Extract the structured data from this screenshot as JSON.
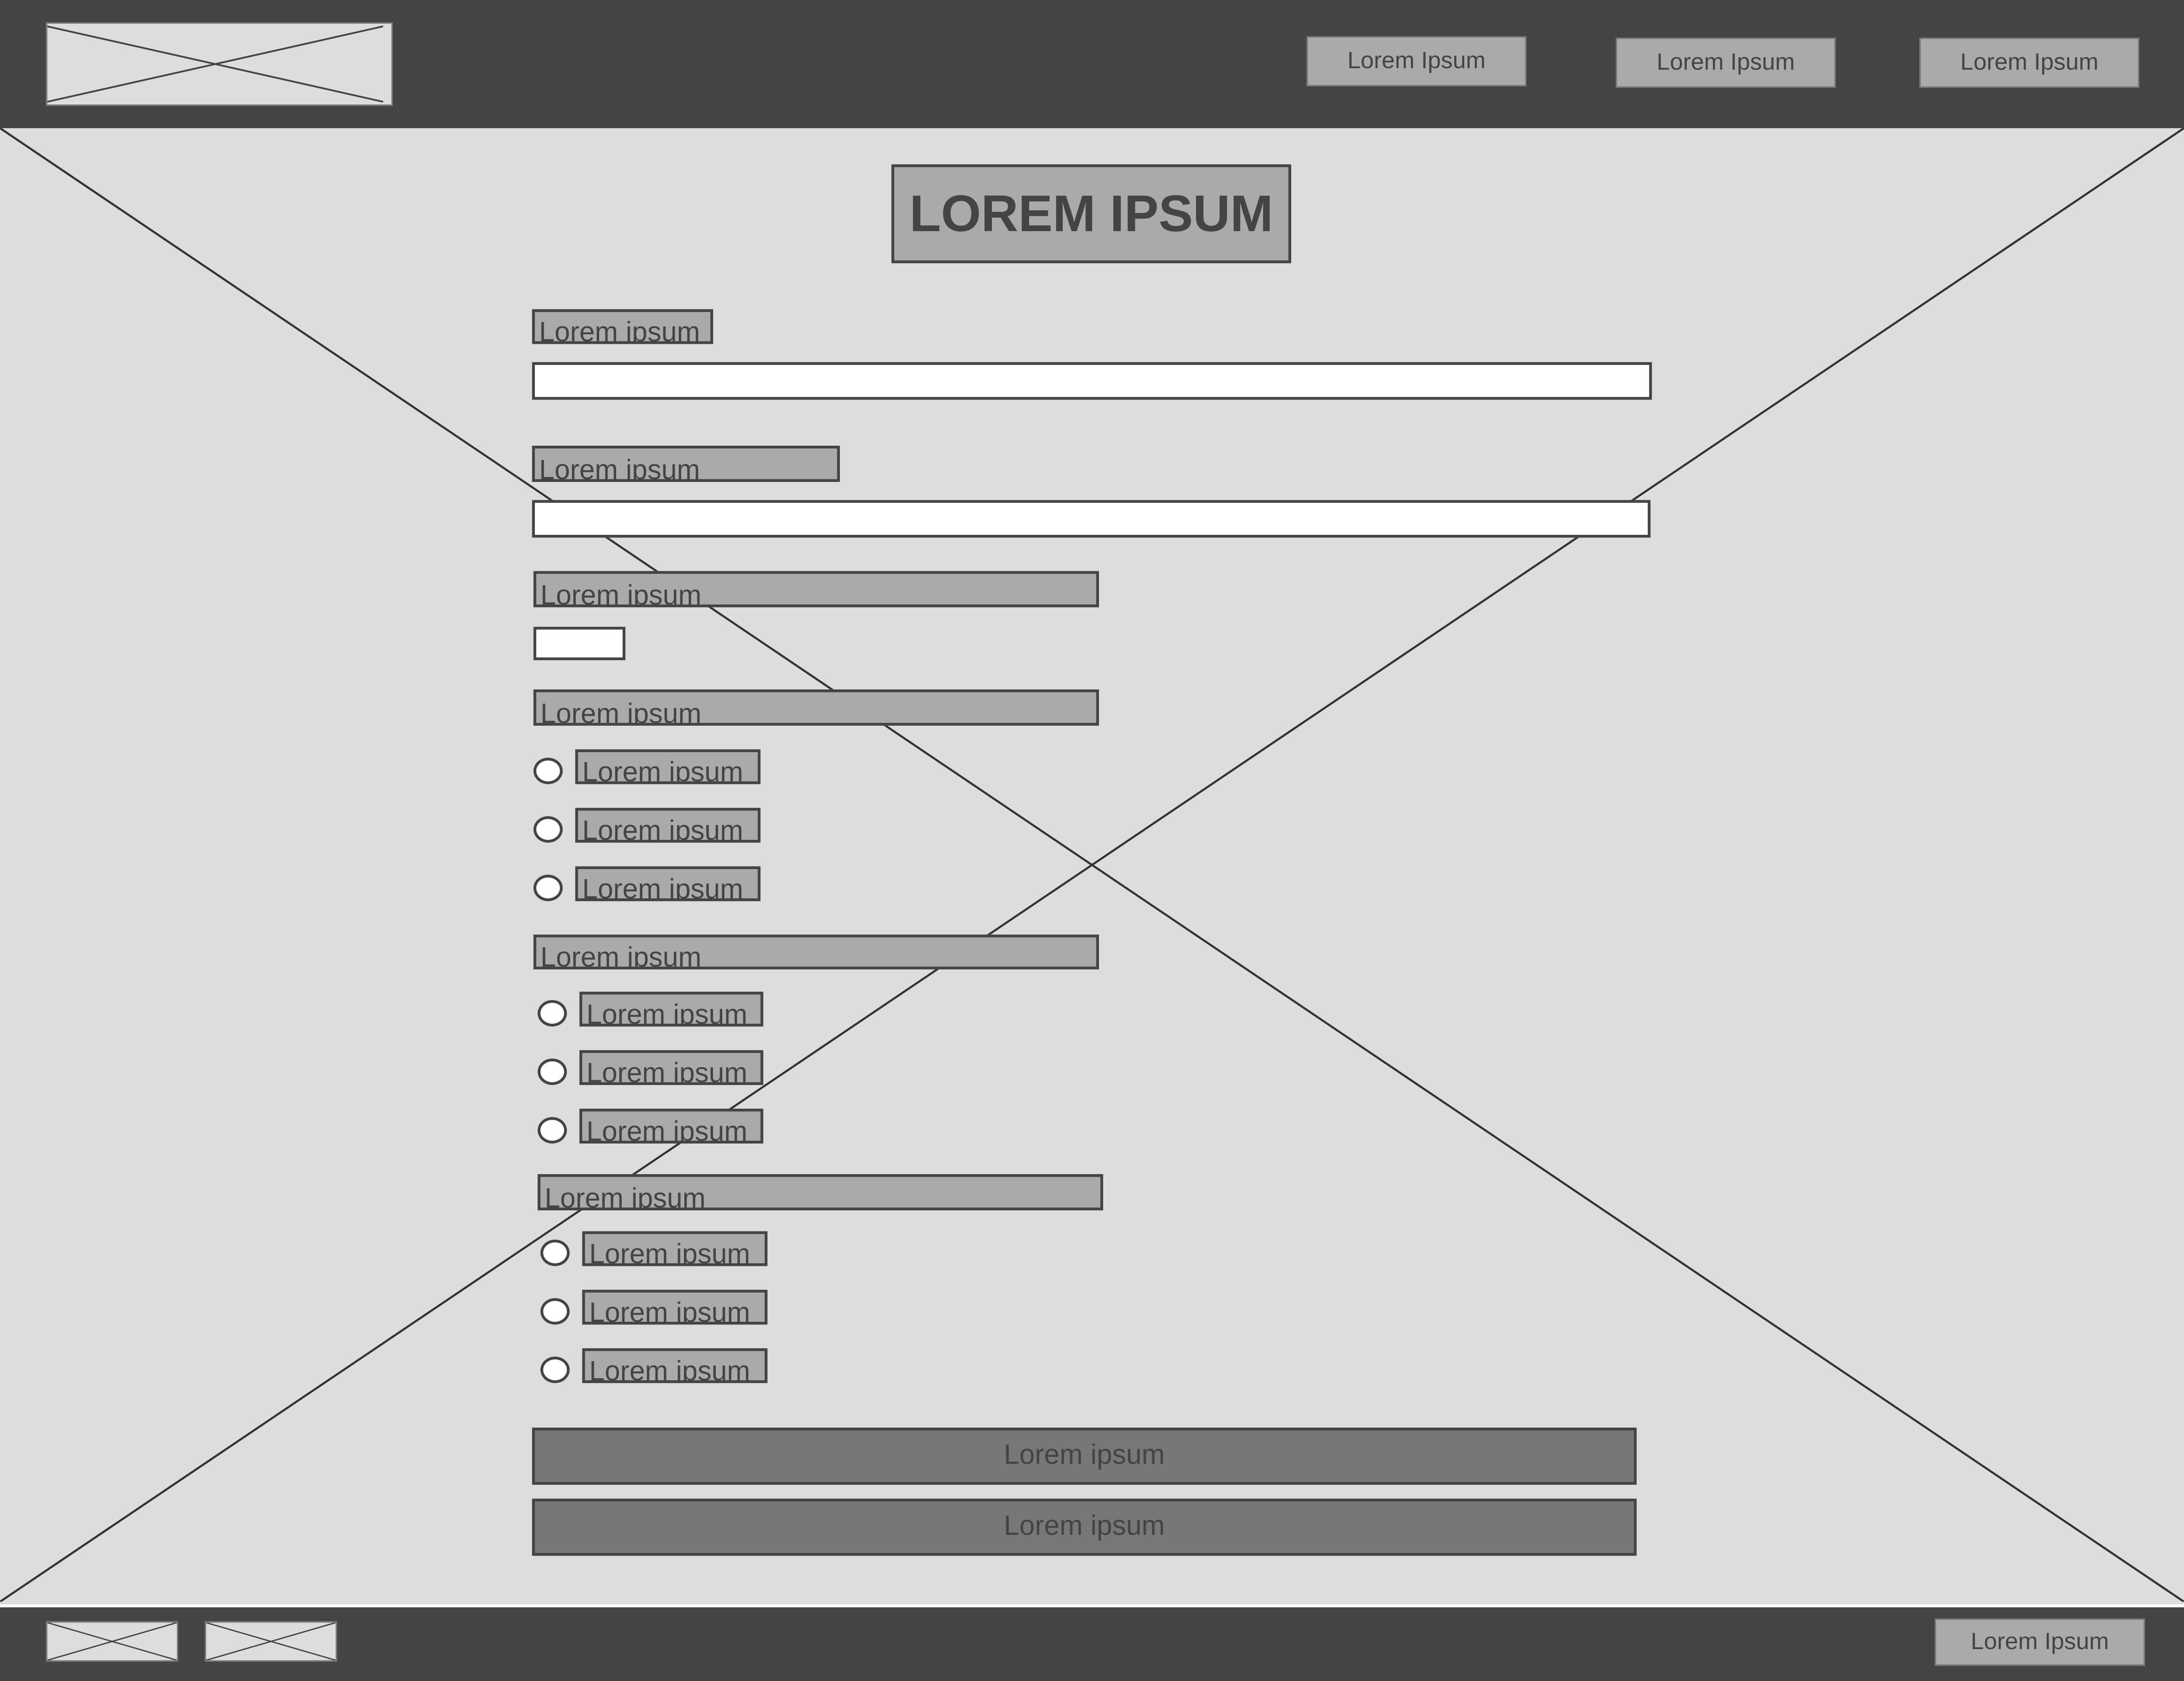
{
  "header": {
    "logo_icon": "image-placeholder-icon",
    "nav": [
      "Lorem Ipsum",
      "Lorem Ipsum",
      "Lorem Ipsum"
    ]
  },
  "main": {
    "background_icon": "image-placeholder-icon",
    "title": "LOREM IPSUM",
    "fields": [
      {
        "label": "Lorem ipsum",
        "value": ""
      },
      {
        "label": "Lorem ipsum",
        "value": ""
      },
      {
        "label": "Lorem ipsum",
        "value": ""
      }
    ],
    "radio_groups": [
      {
        "label": "Lorem ipsum",
        "options": [
          "Lorem ipsum",
          "Lorem ipsum",
          "Lorem ipsum"
        ]
      },
      {
        "label": "Lorem ipsum",
        "options": [
          "Lorem ipsum",
          "Lorem ipsum",
          "Lorem ipsum"
        ]
      },
      {
        "label": "Lorem ipsum",
        "options": [
          "Lorem ipsum",
          "Lorem ipsum",
          "Lorem ipsum"
        ]
      }
    ],
    "buttons": [
      "Lorem ipsum",
      "Lorem ipsum"
    ]
  },
  "footer": {
    "button": "Lorem Ipsum"
  },
  "colors": {
    "dark": "#444444",
    "panel": "#dddddd",
    "box": "#aaaaaa",
    "button": "#777777"
  }
}
